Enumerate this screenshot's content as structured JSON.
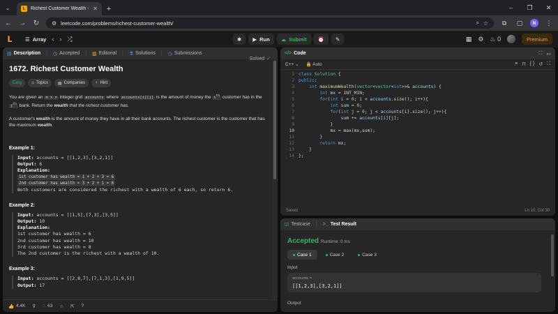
{
  "browser": {
    "tab_title": "Richest Customer Wealth - Lee",
    "url": "leetcode.com/problems/richest-customer-wealth/",
    "profile_initial": "N"
  },
  "nav": {
    "list_label": "Array",
    "run_label": "Run",
    "submit_label": "Submit",
    "streak_count": "0",
    "premium_label": "Premium"
  },
  "desc": {
    "tabs": [
      "Description",
      "Accepted",
      "Editorial",
      "Solutions",
      "Submissions"
    ],
    "title": "1672. Richest Customer Wealth",
    "solved_label": "Solved",
    "tags": [
      "Easy",
      "Topics",
      "Companies",
      "Hint"
    ],
    "p1": {
      "a": "You are given an ",
      "mn": "m x n",
      "b": " integer grid ",
      "acc": "accounts",
      "c": " where ",
      "accij": "accounts[i][j]",
      "d": " is the amount of money the ",
      "ith": "i",
      "th": "th",
      "e": " customer has in the ",
      "j": "j",
      "jth": "th",
      "f": " bank. Return ",
      "g_i": "the ",
      "g_b": "wealth",
      "g_i2": " that the richest customer has."
    },
    "p2": {
      "a": "A customer's ",
      "b": "wealth",
      "c": " is the amount of money they have in all their bank accounts. The richest customer is the customer that has the maximum ",
      "d": "wealth",
      "e": "."
    },
    "examples": [
      {
        "title": "Example 1:",
        "input": "accounts = [[1,2,3],[3,2,1]]",
        "output": "6",
        "lines": [
          "1st customer has wealth = 1 + 2 + 3 = 6",
          "2nd customer has wealth = 3 + 2 + 1 = 6"
        ],
        "note": "Both customers are considered the richest with a wealth of 6 each, so return 6."
      },
      {
        "title": "Example 2:",
        "input": "accounts = [[1,5],[7,3],[3,5]]",
        "output": "10",
        "lines": [
          "1st customer has wealth = 6",
          "2nd customer has wealth = 10",
          "3rd customer has wealth = 8"
        ],
        "note": "The 2nd customer is the richest with a wealth of 10."
      },
      {
        "title": "Example 3:",
        "input": "accounts = [[2,8,7],[7,1,3],[1,9,5]]",
        "output": "17"
      }
    ],
    "input_label": "Input:",
    "output_label": "Output:",
    "explanation_label": "Explanation:",
    "likes": "4.4K",
    "comments": "63"
  },
  "code": {
    "title": "Code",
    "language": "C++",
    "mode": "Auto",
    "status": "Saved",
    "cursor": "Ln 10, Col 30"
  },
  "result": {
    "tabs": [
      "Testcase",
      "Test Result"
    ],
    "verdict": "Accepted",
    "runtime": "Runtime: 0 ms",
    "cases": [
      "Case 1",
      "Case 2",
      "Case 3"
    ],
    "input_label": "Input",
    "var_name": "accounts =",
    "var_value": "[[1,2,3],[3,2,1]]",
    "output_label": "Output"
  },
  "colors": {
    "accent_orange": "#ffa116",
    "accepted_green": "#2cbb5d",
    "easy_teal": "#00b8a3"
  }
}
